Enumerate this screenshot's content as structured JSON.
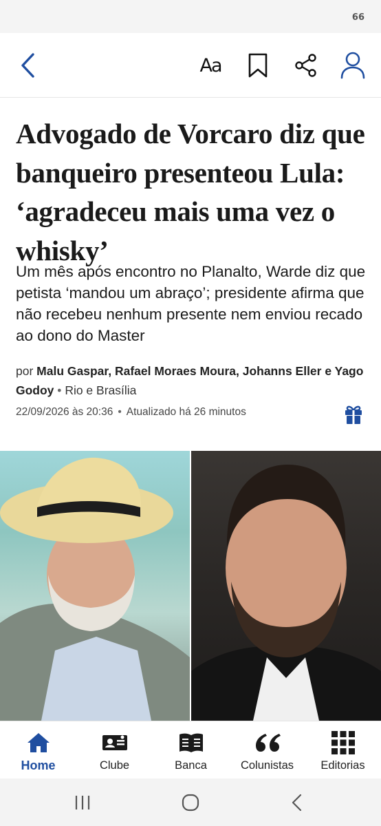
{
  "status_bar": {
    "battery": "66"
  },
  "header": {
    "back_icon": "chevron-left-icon",
    "font_size_icon": "font-size-icon",
    "font_size_label": "Aa",
    "bookmark_icon": "bookmark-icon",
    "share_icon": "share-icon",
    "account_icon": "user-icon"
  },
  "article": {
    "headline": "Advogado de Vorcaro diz que banqueiro presenteou Lula: ‘agradeceu mais uma vez o whisky’",
    "subtitle": "Um mês após encontro no Planalto, Warde diz que petista ‘mandou um abraço’; presidente afirma que não recebeu nenhum presente nem enviou recado ao dono do Master",
    "byline": {
      "prefix": "por",
      "authors": "Malu Gaspar, Rafael Moraes Moura, Johanns Eller e Yago Godoy",
      "separator": "•",
      "location": "Rio e Brasília"
    },
    "published": "22/09/2026 às 20:36",
    "meta_separator": "•",
    "updated": "Atualizado há 26 minutos",
    "gift_icon": "gift-icon"
  },
  "bottom_nav": [
    {
      "label": "Home",
      "icon": "home-icon",
      "active": true
    },
    {
      "label": "Clube",
      "icon": "membership-card-icon",
      "active": false
    },
    {
      "label": "Banca",
      "icon": "open-book-icon",
      "active": false
    },
    {
      "label": "Colunistas",
      "icon": "quote-icon",
      "active": false
    },
    {
      "label": "Editorias",
      "icon": "grid-icon",
      "active": false
    }
  ],
  "colors": {
    "brand_blue": "#1f4ea0",
    "text": "#1a1a1a"
  }
}
